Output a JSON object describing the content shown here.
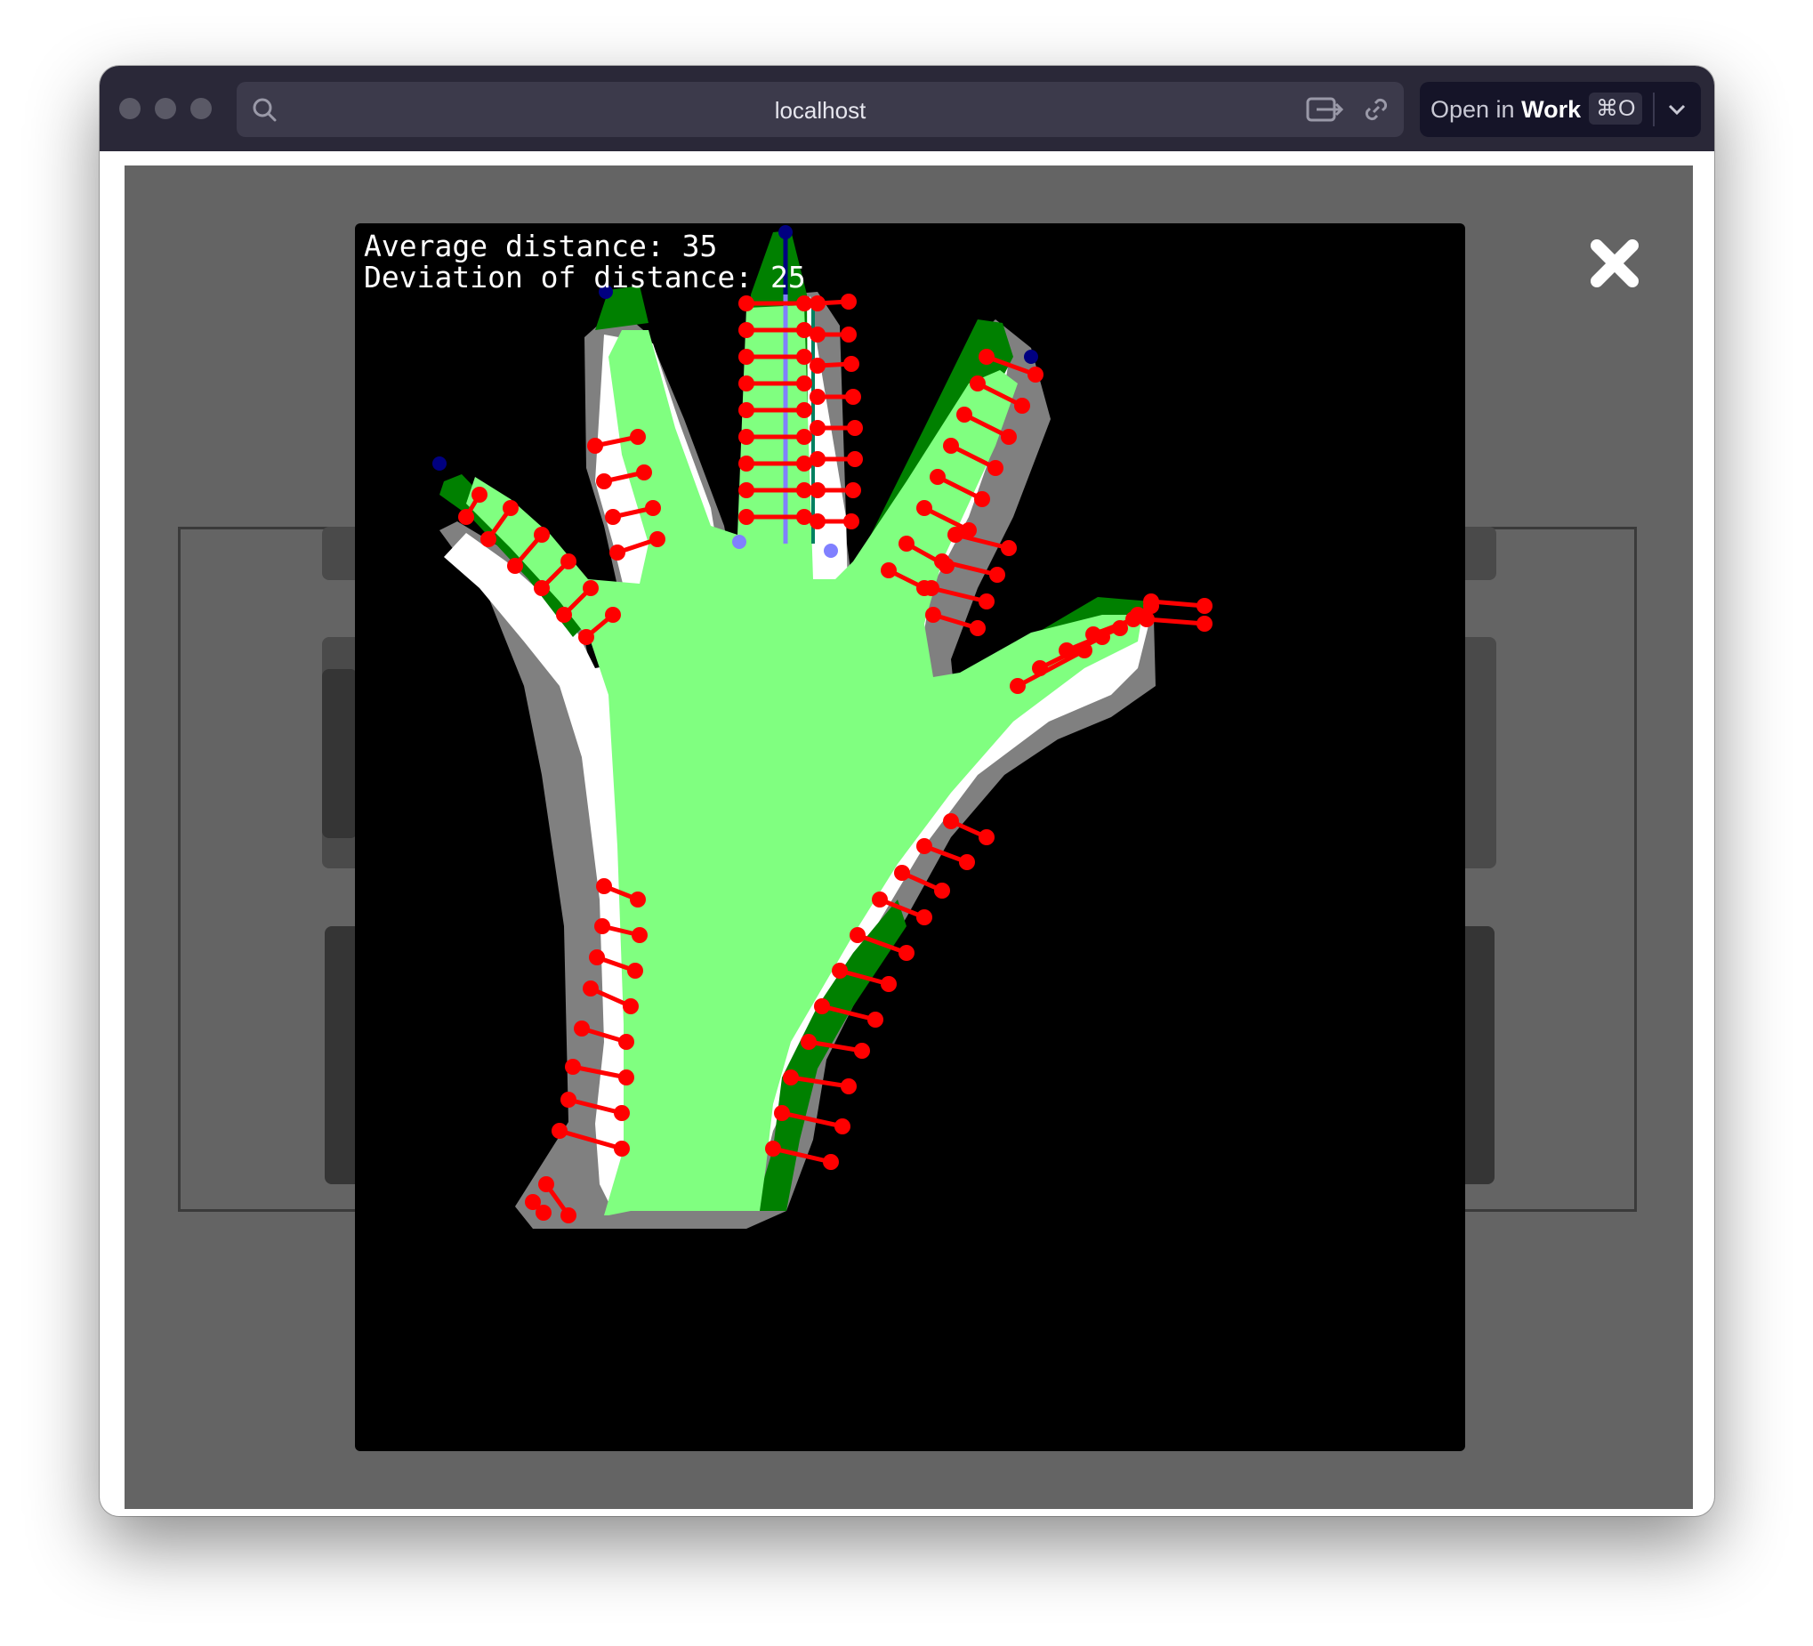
{
  "browser": {
    "url": "localhost",
    "open_in_label": "Open in",
    "open_in_target": "Work",
    "shortcut": "⌘O",
    "icons": {
      "search": "search-icon",
      "share": "share-icon",
      "link": "link-icon",
      "chevron": "chevron-down-icon"
    }
  },
  "page": {
    "modal": {
      "stats": {
        "average_label": "Average distance: 35",
        "deviation_label": "Deviation of distance: 25"
      },
      "close_icon": "close-icon",
      "image_description_colors": {
        "inner_region": "#80ff80",
        "outer_band": "#808080",
        "overlap_band": "#008000",
        "markers": "#ff0000",
        "tip_points": "#000080",
        "base_points": "#8080ff"
      }
    }
  }
}
